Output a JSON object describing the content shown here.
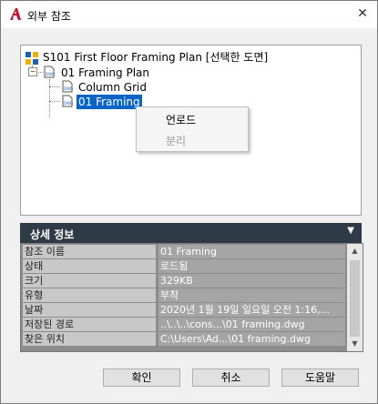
{
  "window": {
    "title": "외부 참조",
    "close_glyph": "✕"
  },
  "tree": {
    "root": {
      "label": "S101 First Floor Framing Plan [선택한 도면]"
    },
    "child": {
      "label": "01 Framing Plan"
    },
    "grand1": {
      "label": "Column Grid"
    },
    "grand2": {
      "label": "01 Framing"
    }
  },
  "context_menu": {
    "items": [
      {
        "label": "언로드",
        "enabled": true
      },
      {
        "label": "분리",
        "enabled": false
      }
    ]
  },
  "details": {
    "heading": "상세 정보",
    "rows": [
      {
        "key": "참조 이름",
        "value": "01 Framing"
      },
      {
        "key": "상태",
        "value": "로드됨"
      },
      {
        "key": "크기",
        "value": "329KB"
      },
      {
        "key": "유형",
        "value": "부착"
      },
      {
        "key": "날짜",
        "value": "2020년 1월 19일 일요일  오전 1:16,..."
      },
      {
        "key": "저장된 경로",
        "value": "..\\..\\..\\cons...\\01 framing.dwg"
      },
      {
        "key": "찾은 위치",
        "value": "C:\\Users\\Ad...\\01 framing.dwg"
      }
    ]
  },
  "buttons": {
    "ok": "확인",
    "cancel": "취소",
    "help": "도움말"
  },
  "colors": {
    "accent": "#0a64c8",
    "details_header": "#2f3a47",
    "app_icon": "#c8102e"
  },
  "icons": {
    "app": "autocad-a-icon",
    "dwg": "dwg-file-icon",
    "root": "sheet-icon"
  }
}
